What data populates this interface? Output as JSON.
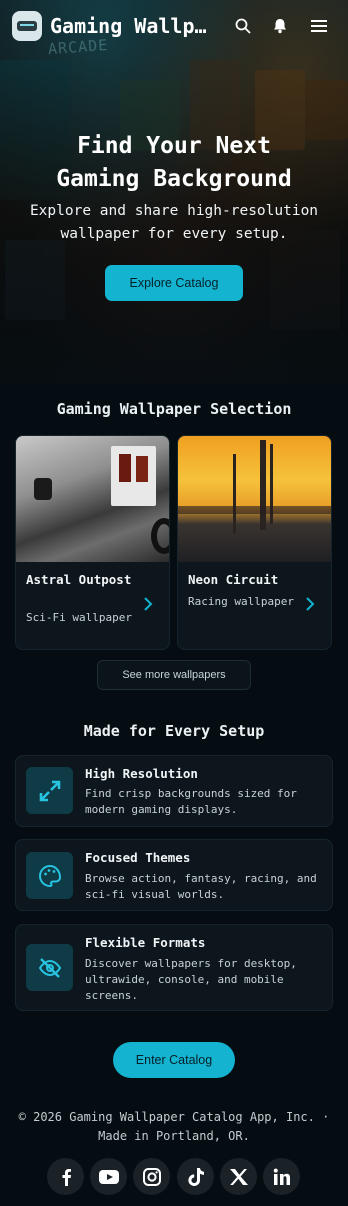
{
  "header": {
    "brand": "Gaming Wallp…",
    "icons": [
      "search-icon",
      "bell-icon",
      "menu-icon"
    ]
  },
  "hero": {
    "title_line1": "Find Your Next",
    "title_line2": "Gaming Background",
    "subtitle": "Explore and share high-resolution wallpaper for every setup.",
    "cta": "Explore Catalog"
  },
  "selection": {
    "title": "Gaming Wallpaper Selection",
    "cards": [
      {
        "title": "Astral Outpost",
        "sub": "Sci-Fi wallpaper"
      },
      {
        "title": "Neon Circuit",
        "sub": "Racing wallpaper"
      }
    ],
    "more": "See more wallpapers"
  },
  "setup": {
    "title": "Made for Every Setup",
    "features": [
      {
        "title": "High Resolution",
        "desc": "Find crisp backgrounds sized for modern gaming displays.",
        "icon": "expand-icon"
      },
      {
        "title": "Focused Themes",
        "desc": "Browse action, fantasy, racing, and sci-fi visual worlds.",
        "icon": "palette-icon"
      },
      {
        "title": "Flexible Formats",
        "desc": "Discover wallpapers for desktop, ultrawide, console, and mobile screens.",
        "icon": "eye-off-icon"
      }
    ]
  },
  "cta_bottom": "Enter Catalog",
  "footer": {
    "text": "© 2026 Gaming Wallpaper Catalog App, Inc. · Made in Portland, OR.",
    "social": [
      "facebook-icon",
      "youtube-icon",
      "instagram-icon",
      "tiktok-icon",
      "x-icon",
      "linkedin-icon"
    ]
  },
  "colors": {
    "accent": "#14b3cf",
    "background": "#060d12",
    "card": "#0c161c",
    "icon_bg": "#0e3b46"
  }
}
